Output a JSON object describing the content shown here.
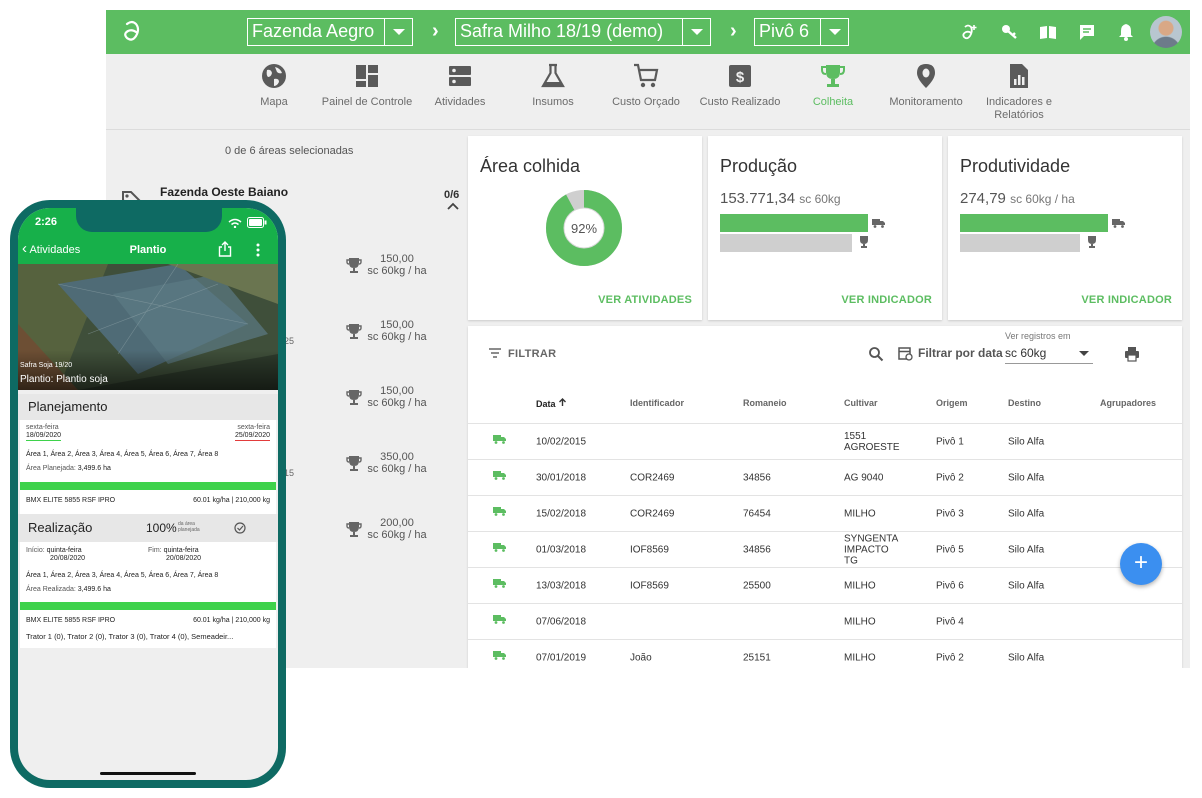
{
  "topbar": {
    "farm": "Fazenda Aegro",
    "season": "Safra Milho 18/19 (demo)",
    "pivot": "Pivô 6",
    "icons": [
      "aegro-logo-icon",
      "add-user-icon",
      "key-icon",
      "book-icon",
      "chat-icon",
      "bell-icon",
      "avatar"
    ]
  },
  "nav": [
    {
      "label": "Mapa",
      "icon": "globe-icon"
    },
    {
      "label": "Painel de Controle",
      "icon": "dashboard-icon"
    },
    {
      "label": "Atividades",
      "icon": "activities-icon"
    },
    {
      "label": "Insumos",
      "icon": "flask-icon"
    },
    {
      "label": "Custo Orçado",
      "icon": "cart-icon"
    },
    {
      "label": "Custo Realizado",
      "icon": "money-icon"
    },
    {
      "label": "Colheita",
      "icon": "trophy-icon",
      "active": true
    },
    {
      "label": "Monitoramento",
      "icon": "bug-pin-icon"
    },
    {
      "label": "Indicadores e Relatórios",
      "icon": "report-icon"
    }
  ],
  "left": {
    "selection": "0 de 6 áreas selecionadas",
    "farm_name": "Fazenda Oeste Baiano",
    "farm_count": "0/6",
    "yields": [
      {
        "value": "150,00",
        "unit": "sc 60kg / ha"
      },
      {
        "value": "150,00",
        "unit": "sc 60kg / ha"
      },
      {
        "value": "150,00",
        "unit": "sc 60kg / ha"
      },
      {
        "value": "350,00",
        "unit": "sc 60kg / ha"
      },
      {
        "value": "200,00",
        "unit": "sc 60kg / ha"
      }
    ],
    "fragments": [
      "25",
      "15"
    ]
  },
  "cards": {
    "area": {
      "title": "Área colhida",
      "percent": 92,
      "percent_label": "92%",
      "link": "VER ATIVIDADES"
    },
    "producao": {
      "title": "Produção",
      "value": "153.771,34",
      "unit": "sc 60kg",
      "link": "VER INDICADOR",
      "harvested_fraction": 1.0,
      "expected_fraction": 0.89
    },
    "produtividade": {
      "title": "Produtividade",
      "value": "274,79",
      "unit": "sc 60kg / ha",
      "link": "VER INDICADOR",
      "harvested_fraction": 1.0,
      "expected_fraction": 0.81
    }
  },
  "table": {
    "filter_label": "FILTRAR",
    "date_filter": "Filtrar por data",
    "records_label": "Ver registros em",
    "records_value": "sc 60kg",
    "headers": [
      "Data",
      "Identificador",
      "Romaneio",
      "Cultivar",
      "Origem",
      "Destino",
      "Agrupadores"
    ],
    "rows": [
      [
        "10/02/2015",
        "",
        "",
        "1551 AGROESTE",
        "Pivô 1",
        "Silo Alfa"
      ],
      [
        "30/01/2018",
        "COR2469",
        "34856",
        "AG 9040",
        "Pivô 2",
        "Silo Alfa"
      ],
      [
        "15/02/2018",
        "COR2469",
        "76454",
        "MILHO",
        "Pivô 3",
        "Silo Alfa"
      ],
      [
        "01/03/2018",
        "IOF8569",
        "34856",
        "SYNGENTA IMPACTO TG",
        "Pivô 5",
        "Silo Alfa"
      ],
      [
        "13/03/2018",
        "IOF8569",
        "25500",
        "MILHO",
        "Pivô 6",
        "Silo Alfa"
      ],
      [
        "07/06/2018",
        "",
        "",
        "MILHO",
        "Pivô 4",
        ""
      ],
      [
        "07/01/2019",
        "João",
        "25151",
        "MILHO",
        "Pivô 2",
        "Silo Alfa"
      ]
    ],
    "fab": "+"
  },
  "phone": {
    "time": "2:26",
    "back": "Atividades",
    "title": "Plantio",
    "photo_season": "Safra Soja 19/20",
    "photo_title": "Plantio: Plantio soja",
    "planejamento": {
      "section": "Planejamento",
      "start_day": "sexta-feira",
      "start_date": "18/09/2020",
      "end_day": "sexta-feira",
      "end_date": "25/09/2020",
      "areas": "Área 1, Área 2, Área 3, Área 4, Área 5, Área 6, Área 7, Área 8",
      "area_label": "Área Planejada:",
      "area_value": "3,499.6 ha",
      "product": "BMX ELITE 5855 RSF IPRO",
      "rate": "60.01 kg/ha | 210,000 kg"
    },
    "realizacao": {
      "section": "Realização",
      "percent": "100%",
      "percent_note": "da área planejada",
      "inicio_label": "Início:",
      "inicio_day": "quinta-feira",
      "inicio_date": "20/08/2020",
      "fim_label": "Fim:",
      "fim_day": "quinta-feira",
      "fim_date": "20/08/2020",
      "areas": "Área 1, Área 2, Área 3, Área 4, Área 5, Área 6, Área 7, Área 8",
      "area_label": "Área Realizada:",
      "area_value": "3,499.6 ha",
      "product": "BMX ELITE 5855 RSF IPRO",
      "rate": "60.01 kg/ha | 210,000 kg",
      "machines": "Trator 1 (0), Trator 2 (0), Trator 3 (0), Trator 4 (0), Semeadeir..."
    }
  },
  "colors": {
    "green": "#5cbd61",
    "phone_green": "#17b04a",
    "fab": "#3b8ff0",
    "frame": "#0e6a63"
  }
}
